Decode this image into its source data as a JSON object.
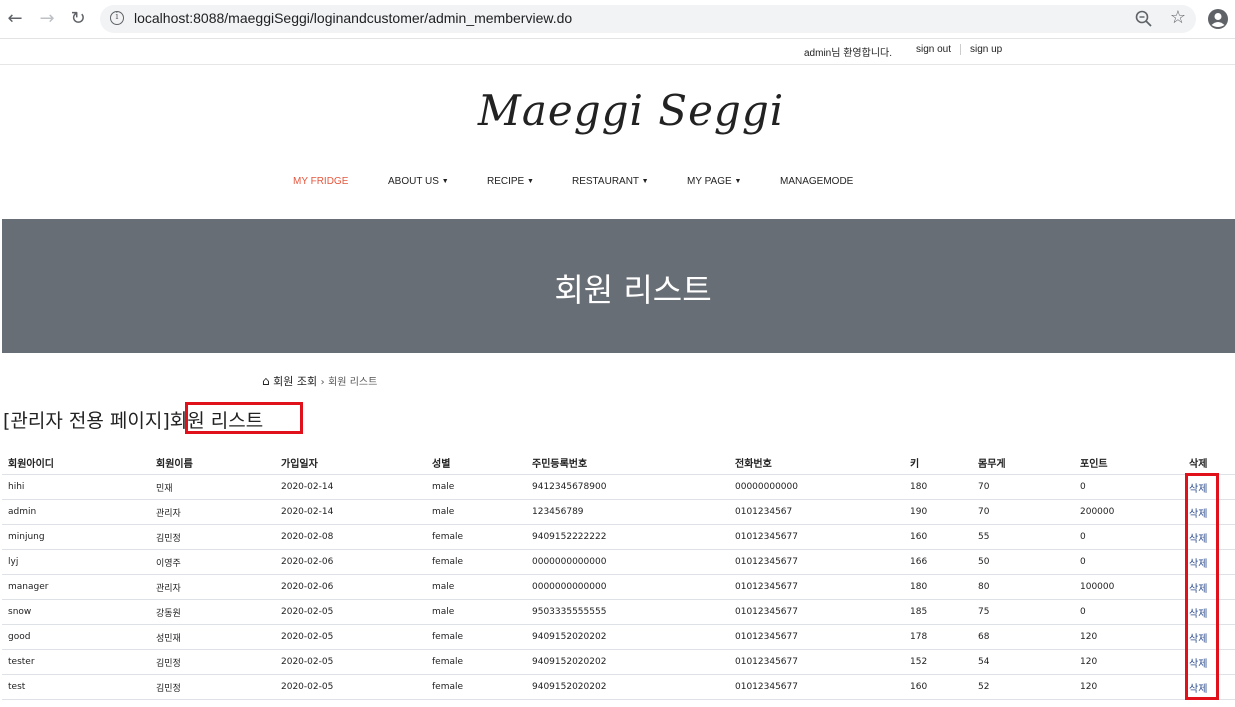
{
  "browser": {
    "url": "localhost:8088/maeggiSeggi/loginandcustomer/admin_memberview.do"
  },
  "top": {
    "welcome": "admin님 환영합니다.",
    "signout": "sign out",
    "signup": "sign up"
  },
  "brand": "Maeggi Seggi",
  "menu": [
    {
      "label": "MY FRIDGE"
    },
    {
      "label": "ABOUT US"
    },
    {
      "label": "RECIPE"
    },
    {
      "label": "RESTAURANT"
    },
    {
      "label": "MY PAGE"
    },
    {
      "label": "MANAGEMODE"
    }
  ],
  "banner": {
    "title": "회원 리스트"
  },
  "breadcrumb": {
    "parent": "회원 조회",
    "sep": "›",
    "current": "회원 리스트"
  },
  "heading": {
    "prefix": "[관리자 전용 페이지]",
    "highlight": "회원 리스트"
  },
  "table": {
    "headers": [
      "회원아이디",
      "회원이름",
      "가입일자",
      "성별",
      "주민등록번호",
      "전화번호",
      "키",
      "몸무게",
      "포인트",
      "삭제"
    ],
    "rows": [
      [
        "hihi",
        "민재",
        "2020-02-14",
        "male",
        "9412345678900",
        "00000000000",
        "180",
        "70",
        "0",
        "삭제"
      ],
      [
        "admin",
        "관리자",
        "2020-02-14",
        "male",
        "123456789",
        "0101234567",
        "190",
        "70",
        "200000",
        "삭제"
      ],
      [
        "minjung",
        "김민정",
        "2020-02-08",
        "female",
        "9409152222222",
        "01012345677",
        "160",
        "55",
        "0",
        "삭제"
      ],
      [
        "lyj",
        "이영주",
        "2020-02-06",
        "female",
        "0000000000000",
        "01012345677",
        "166",
        "50",
        "0",
        "삭제"
      ],
      [
        "manager",
        "관리자",
        "2020-02-06",
        "male",
        "0000000000000",
        "01012345677",
        "180",
        "80",
        "100000",
        "삭제"
      ],
      [
        "snow",
        "강동원",
        "2020-02-05",
        "male",
        "9503335555555",
        "01012345677",
        "185",
        "75",
        "0",
        "삭제"
      ],
      [
        "good",
        "성민재",
        "2020-02-05",
        "female",
        "9409152020202",
        "01012345677",
        "178",
        "68",
        "120",
        "삭제"
      ],
      [
        "tester",
        "김민정",
        "2020-02-05",
        "female",
        "9409152020202",
        "01012345677",
        "152",
        "54",
        "120",
        "삭제"
      ],
      [
        "test",
        "김민정",
        "2020-02-05",
        "female",
        "9409152020202",
        "01012345677",
        "160",
        "52",
        "120",
        "삭제"
      ]
    ]
  },
  "colors": {
    "active_menu": "#e4573d",
    "banner": "#686e75",
    "highlight_border": "#e0111b",
    "link": "#2a4b8d"
  },
  "icons": [
    "back-arrow-icon",
    "forward-arrow-icon",
    "reload-icon",
    "info-icon",
    "zoom-icon",
    "star-icon",
    "profile-icon",
    "home-icon"
  ]
}
